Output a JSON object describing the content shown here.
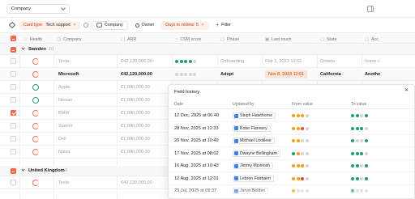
{
  "topbar": {
    "entity": "Company"
  },
  "filters": {
    "card_type_key": "Card type:",
    "card_type_value": "Tech support",
    "company": "Company",
    "owner": "Owner",
    "days_to_review": "Days to review: 5",
    "add_filter": "Filter"
  },
  "columns": {
    "health": "Health",
    "company": "Company",
    "arr": "ARR",
    "csm": "CSM score",
    "phase": "Phase",
    "last_touch": "Last touch",
    "state": "State",
    "account": "Acc"
  },
  "groups": [
    {
      "name": "Sweden",
      "count": "10"
    },
    {
      "name": "United Kingdom",
      "count": "9"
    }
  ],
  "rows": [
    {
      "company": "Tesla",
      "arr": "€42,120,000.00",
      "phase": "Onboarding",
      "last_touch": "Feb 1, 2023 12:51",
      "state": "Ontario",
      "account": "Some c"
    },
    {
      "company": "Microsoft",
      "arr": "€42,120,000.00",
      "phase": "Adopt",
      "last_touch": "Nov 8, 2023 12:51",
      "state": "California",
      "account": "Anothe"
    },
    {
      "company": "Apple",
      "arr": "€1,000,000.00"
    },
    {
      "company": "Nissan",
      "arr": "€1,000,000.00"
    },
    {
      "company": "BMW",
      "arr": "€1,000,000.00"
    },
    {
      "company": "Xiaomi",
      "arr": "€1,000,000.00"
    },
    {
      "company": "Dell",
      "arr": "€1,000,000.00"
    },
    {
      "company": "Nokia",
      "arr": "€1,000,000.00"
    },
    {
      "company": "Tesla",
      "arr": "€42,120,000.00"
    }
  ],
  "colors": {
    "accent": "#f2684a",
    "green": "#22a06b",
    "orange": "#f59e0b",
    "red": "#ef4444",
    "grey": "#d4d4d8"
  },
  "field_history": {
    "title": "Field history",
    "headers": {
      "date": "Date",
      "updated_by": "Updated by",
      "from": "From value",
      "to": "To value"
    },
    "entries": [
      {
        "date": "12 Dec, 2025 at 06:40",
        "user": "Steph Hawthorne",
        "from": [
          "orange",
          "orange",
          "orange",
          "grey"
        ],
        "to": [
          "green",
          "green",
          "grey",
          "green"
        ]
      },
      {
        "date": "28 Nov, 2025 at 12:33",
        "user": "Kobe Flannery",
        "from": [
          "orange",
          "orange",
          "red",
          "grey"
        ],
        "to": [
          "green",
          "green",
          "green",
          "grey"
        ]
      },
      {
        "date": "20 Nov, 2025 at 10:49",
        "user": "Michael Locklear",
        "from": [
          "orange",
          "orange",
          "grey",
          "grey"
        ],
        "to": [
          "green",
          "grey",
          "grey",
          "green"
        ]
      },
      {
        "date": "17 Nov, 2025 at 08:02",
        "user": "Dwayne Bellingham",
        "from": [
          "green",
          "orange",
          "grey",
          "grey"
        ],
        "to": [
          "green",
          "green",
          "green",
          "grey"
        ]
      },
      {
        "date": "16 Aug, 2025 at 10:43",
        "user": "Jimmy Mcintosh",
        "from": [
          "orange",
          "orange",
          "orange",
          "grey"
        ],
        "to": [
          "green",
          "green",
          "grey",
          "green"
        ]
      },
      {
        "date": "12 Aug, 2025 at 12:01",
        "user": "Lebron Fairbairn",
        "from": [
          "orange",
          "orange",
          "red",
          "grey"
        ],
        "to": [
          "green",
          "green",
          "grey",
          "green"
        ]
      },
      {
        "date": "29 Jul, 2025 at 09:37",
        "user": "Jarvis Bolden",
        "from": [
          "orange",
          "grey",
          "grey",
          "grey"
        ],
        "to": [
          "green",
          "grey",
          "grey",
          "grey"
        ]
      }
    ]
  }
}
